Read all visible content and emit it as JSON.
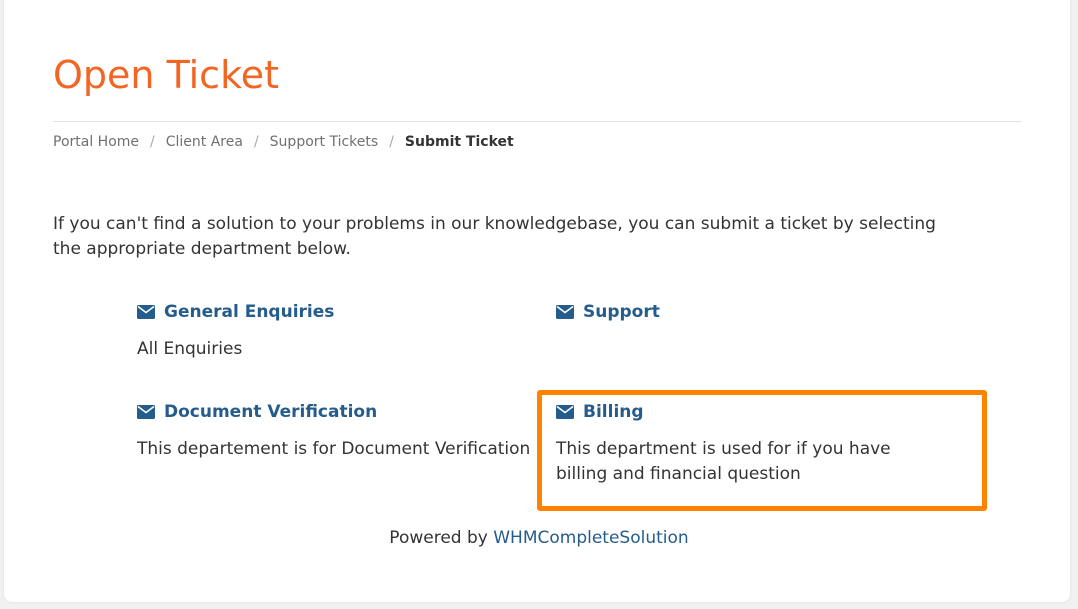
{
  "page": {
    "title": "Open Ticket"
  },
  "breadcrumb": {
    "items": [
      "Portal Home",
      "Client Area",
      "Support Tickets"
    ],
    "separator": "/",
    "current": "Submit Ticket"
  },
  "intro_text": "If you can't find a solution to your problems in our knowledgebase, you can submit a ticket by selecting the appropriate department below.",
  "departments": [
    {
      "name": "General Enquiries",
      "description": "All Enquiries",
      "icon": "envelope-icon"
    },
    {
      "name": "Support",
      "description": "",
      "icon": "envelope-icon"
    },
    {
      "name": "Document Verification",
      "description": "This departement is for Document Verification",
      "icon": "envelope-icon"
    },
    {
      "name": "Billing",
      "description": "This department is used for if you have billing and financial question",
      "icon": "envelope-icon"
    }
  ],
  "footer": {
    "prefix": "Powered by",
    "link_text": "WHMCompleteSolution"
  },
  "colors": {
    "title": "#f26522",
    "link": "#245c8c",
    "highlight": "#ff8200"
  }
}
